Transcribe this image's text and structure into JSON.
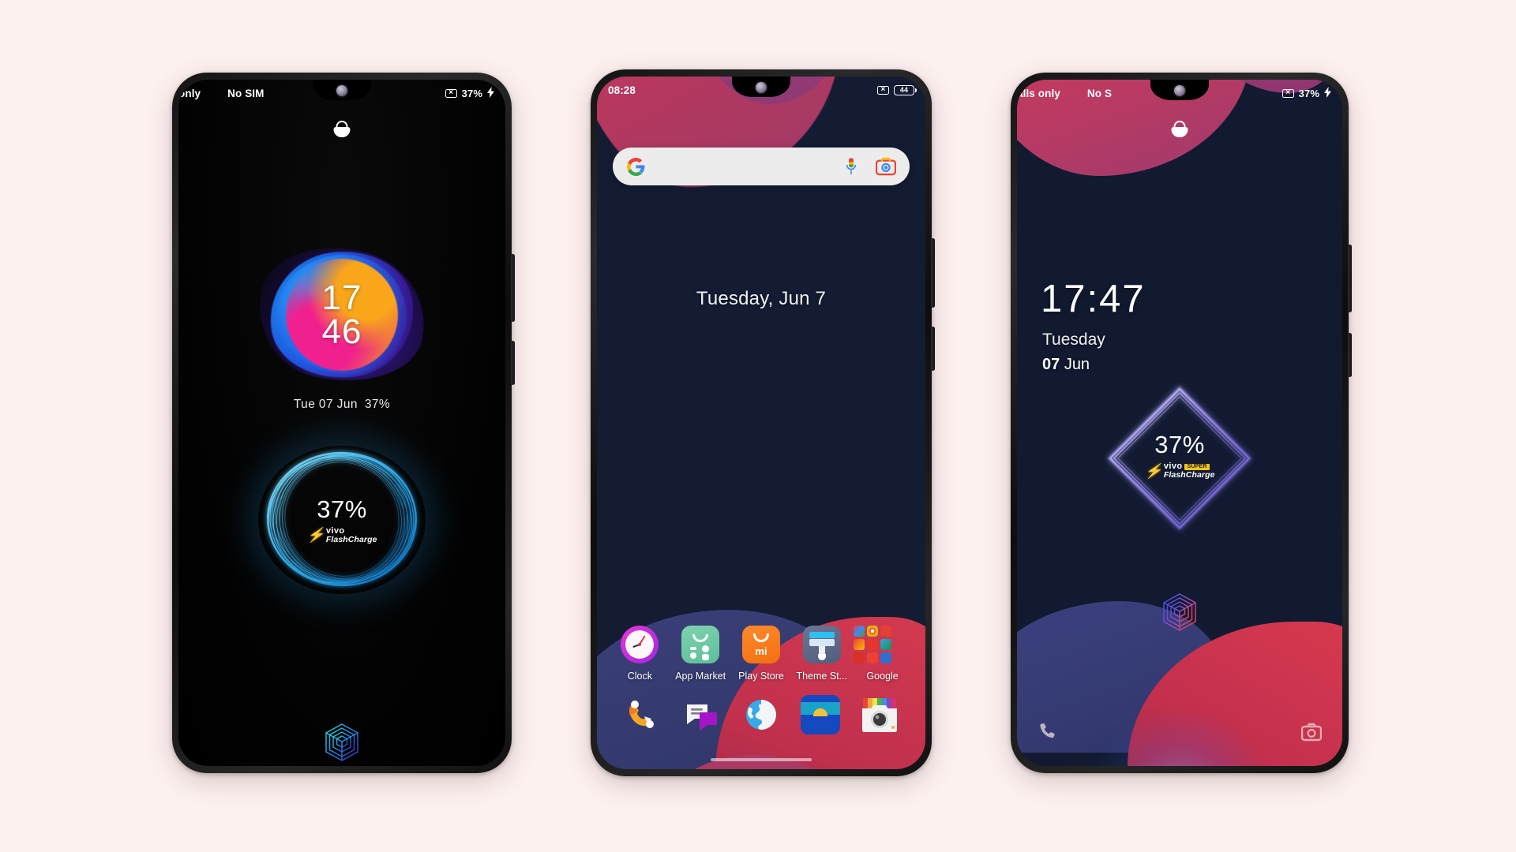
{
  "page": {
    "background": "#fdf1f0",
    "title": "vivo phone UI triptych"
  },
  "phone1": {
    "type": "always-on-display",
    "status_bar": {
      "carrier_clipped": "only",
      "sim": "No SIM",
      "no_signal_icon": "no-signal-icon",
      "battery_percent": "37%",
      "charging_bolt": "⚡"
    },
    "lock_icon": "lock-closed-icon",
    "clock_widget": {
      "hours": "17",
      "minutes": "46",
      "style": "gradient-blob"
    },
    "info_line": {
      "date": "Tue 07 Jun",
      "battery": "37%"
    },
    "charge_widget": {
      "percent": "37%",
      "brand": "vivo",
      "badge": "",
      "product": "FlashCharge",
      "ring_color": "#37b6f0"
    },
    "fingerprint_icon": "fingerprint-cube-icon"
  },
  "phone2": {
    "type": "home-screen",
    "status_bar": {
      "time": "08:28",
      "no_signal_icon": "no-signal-icon",
      "battery_level": "44"
    },
    "search": {
      "placeholder": "",
      "value": "",
      "google_icon": "google-g-icon",
      "mic_icon": "microphone-icon",
      "lens_icon": "google-lens-icon"
    },
    "date_widget": "Tuesday, Jun 7",
    "apps": [
      {
        "label": "Clock",
        "icon": "clock-app-icon"
      },
      {
        "label": "App Market",
        "icon": "app-market-icon"
      },
      {
        "label": "Play Store",
        "icon": "play-store-icon"
      },
      {
        "label": "Theme St...",
        "icon": "theme-store-icon"
      },
      {
        "label": "Google",
        "icon": "google-folder-icon"
      }
    ],
    "app_drawer_handle": "chevron-up-icon",
    "dock": [
      {
        "label": "Phone",
        "icon": "phone-dialer-icon"
      },
      {
        "label": "Messages",
        "icon": "messages-icon"
      },
      {
        "label": "Browser",
        "icon": "browser-globe-icon"
      },
      {
        "label": "Gallery",
        "icon": "gallery-icon"
      },
      {
        "label": "Camera",
        "icon": "camera-icon"
      }
    ],
    "home_indicator": "home-gesture-bar"
  },
  "phone3": {
    "type": "lock-screen",
    "status_bar": {
      "carrier_clipped": "alls only",
      "sim_clipped": "No S",
      "no_signal_icon": "no-signal-icon",
      "battery_percent": "37%",
      "charging_bolt": "⚡"
    },
    "lock_icon": "lock-closed-icon",
    "clock": {
      "time": "17:47",
      "weekday": "Tuesday",
      "day": "07",
      "month": "Jun"
    },
    "charge_widget": {
      "percent": "37%",
      "brand": "vivo",
      "badge": "SUPER",
      "product": "FlashCharge",
      "ring_color": "#9a8ee8"
    },
    "fingerprint_icon": "fingerprint-cube-icon",
    "shortcuts": [
      {
        "name": "phone-shortcut",
        "icon": "phone-handset-icon"
      },
      {
        "name": "camera-shortcut",
        "icon": "camera-shutter-icon"
      }
    ]
  }
}
